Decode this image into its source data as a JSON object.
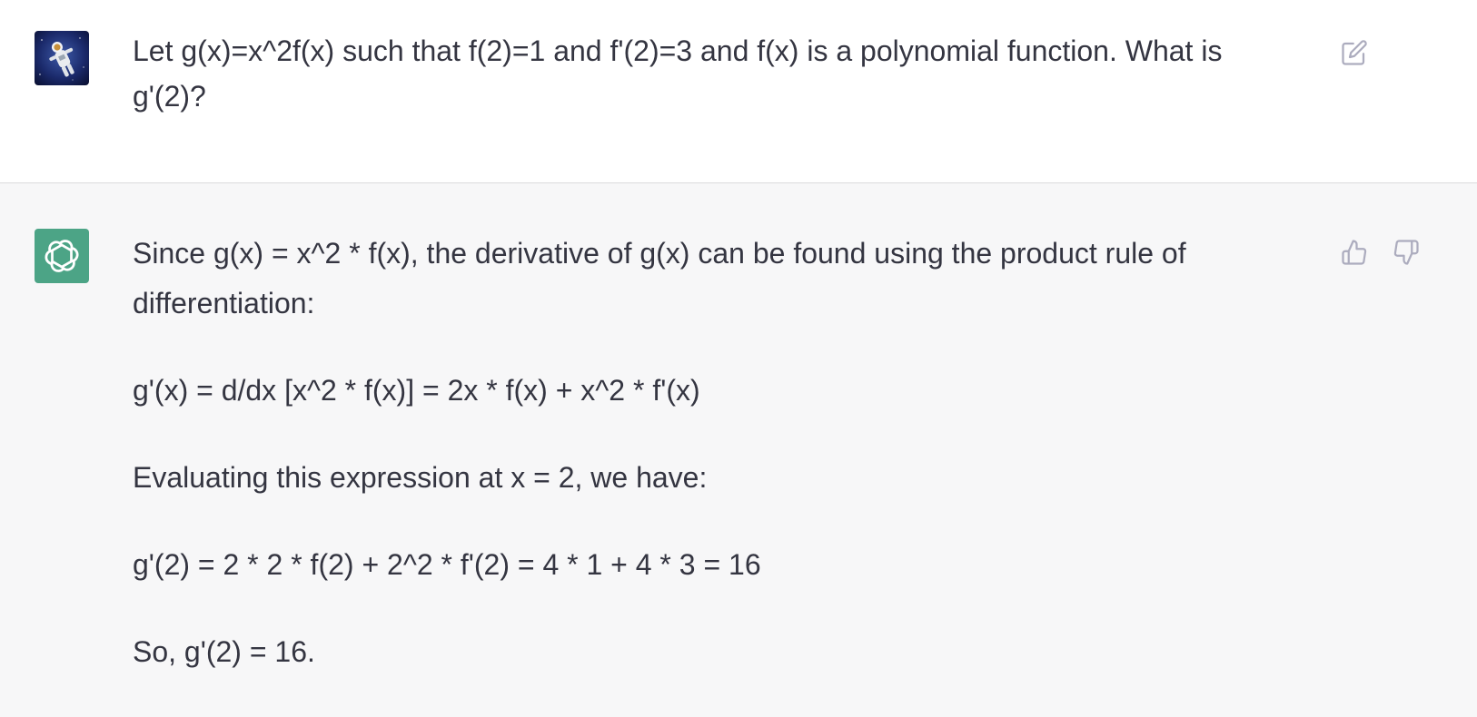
{
  "conversation": {
    "user": {
      "avatar_icon": "astronaut-avatar",
      "message": "Let g(x)=x^2f(x) such that f(2)=1 and f'(2)=3 and f(x) is a polynomial function. What is g'(2)?",
      "edit_icon": "edit-icon"
    },
    "assistant": {
      "avatar_icon": "openai-logo-icon",
      "avatar_color": "#4ca486",
      "paragraphs": [
        "Since g(x) = x^2 * f(x), the derivative of g(x) can be found using the product rule of differentiation:",
        "g'(x) = d/dx [x^2 * f(x)] = 2x * f(x) + x^2 * f'(x)",
        "Evaluating this expression at x = 2, we have:",
        "g'(2) = 2 * 2 * f(2) + 2^2 * f'(2) = 4 * 1 + 4 * 3 = 16",
        "So, g'(2) = 16."
      ],
      "thumb_up_icon": "thumbs-up-icon",
      "thumb_down_icon": "thumbs-down-icon"
    }
  },
  "colors": {
    "text": "#343541",
    "assistant_bg": "#f7f7f8",
    "icon": "#acacbe"
  }
}
